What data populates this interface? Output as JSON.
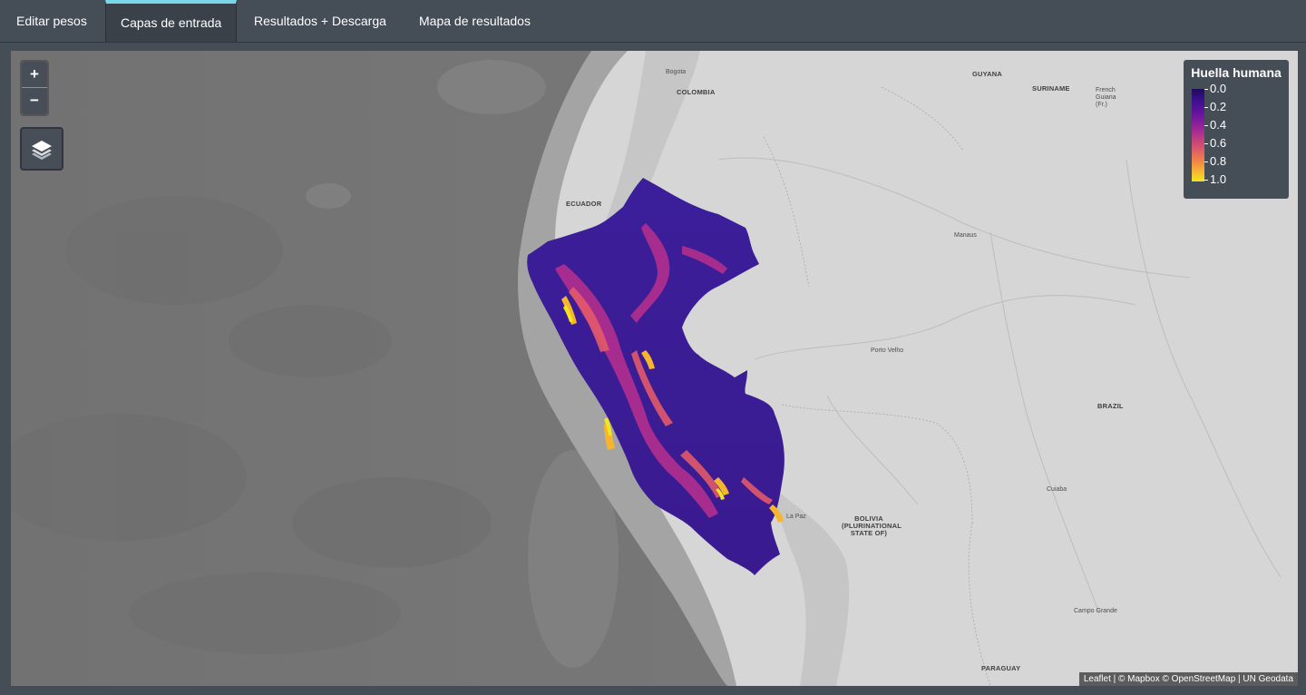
{
  "tabs": [
    {
      "label": "Editar pesos",
      "active": false
    },
    {
      "label": "Capas de entrada",
      "active": true
    },
    {
      "label": "Resultados + Descarga",
      "active": false
    },
    {
      "label": "Mapa de resultados",
      "active": false
    }
  ],
  "map": {
    "zoom_in_label": "+",
    "zoom_out_label": "−",
    "layers_icon": "layers-icon",
    "legend": {
      "title": "Huella humana",
      "labels": [
        "0.0",
        "0.2",
        "0.4",
        "0.6",
        "0.8",
        "1.0"
      ],
      "colors": [
        "#1c0b5c",
        "#6a14a0",
        "#d6506f",
        "#f7c22e",
        "#f0e522"
      ]
    },
    "attribution": {
      "leaflet": "Leaflet",
      "rest": "| © Mapbox © OpenStreetMap | UN Geodata"
    },
    "countries": {
      "colombia": "COLOMBIA",
      "guyana": "GUYANA",
      "suriname": "SURINAME",
      "ecuador": "ECUADOR",
      "brazil": "BRAZIL",
      "bolivia": "BOLIVIA (PLURINATIONAL STATE OF)",
      "paraguay": "PARAGUAY"
    },
    "cities": {
      "bogota": "Bogota",
      "manaus": "Manaus",
      "porto_velho": "Porto Velho",
      "la_paz": "La Paz",
      "french_guiana": "French Guiana (Fr.)",
      "cuiaba": "Cuiaba",
      "campo_grande": "Campo Grande"
    }
  }
}
